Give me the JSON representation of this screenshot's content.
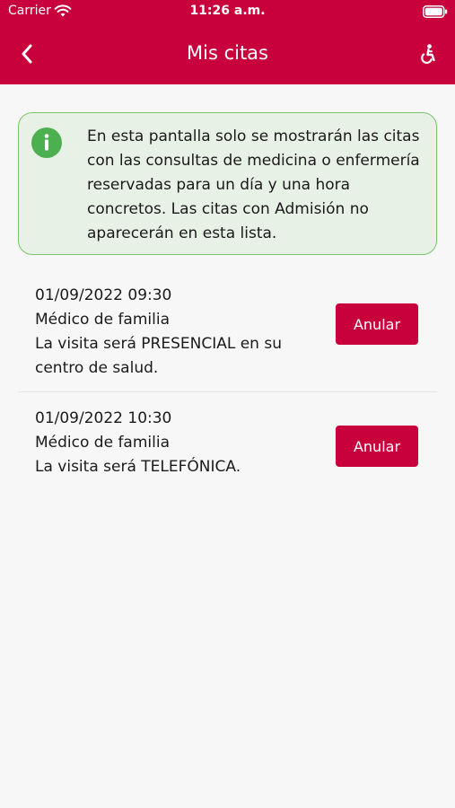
{
  "status_bar": {
    "carrier": "Carrier",
    "time": "11:26 a.m."
  },
  "nav": {
    "title": "Mis citas",
    "back_icon": "chevron-left-icon",
    "accessibility_icon": "accessibility-icon"
  },
  "info": {
    "icon": "info-icon",
    "text": "En esta pantalla solo se mostrarán las citas con las consultas de medicina o enfermería reservadas para un día y una hora concretos. Las citas con Admisión no aparecerán en esta lista."
  },
  "appointments": [
    {
      "datetime": "01/09/2022 09:30",
      "type": "Médico de familia",
      "mode": "La visita será PRESENCIAL en su centro de salud.",
      "cancel_label": "Anular"
    },
    {
      "datetime": "01/09/2022 10:30",
      "type": "Médico de familia",
      "mode": "La visita será TELEFÓNICA.",
      "cancel_label": "Anular"
    }
  ],
  "colors": {
    "brand": "#c8003c",
    "info_background": "#e8f1e5",
    "info_border": "#7cc36c",
    "info_icon": "#4caf50",
    "page_background": "#f7f7f7"
  }
}
